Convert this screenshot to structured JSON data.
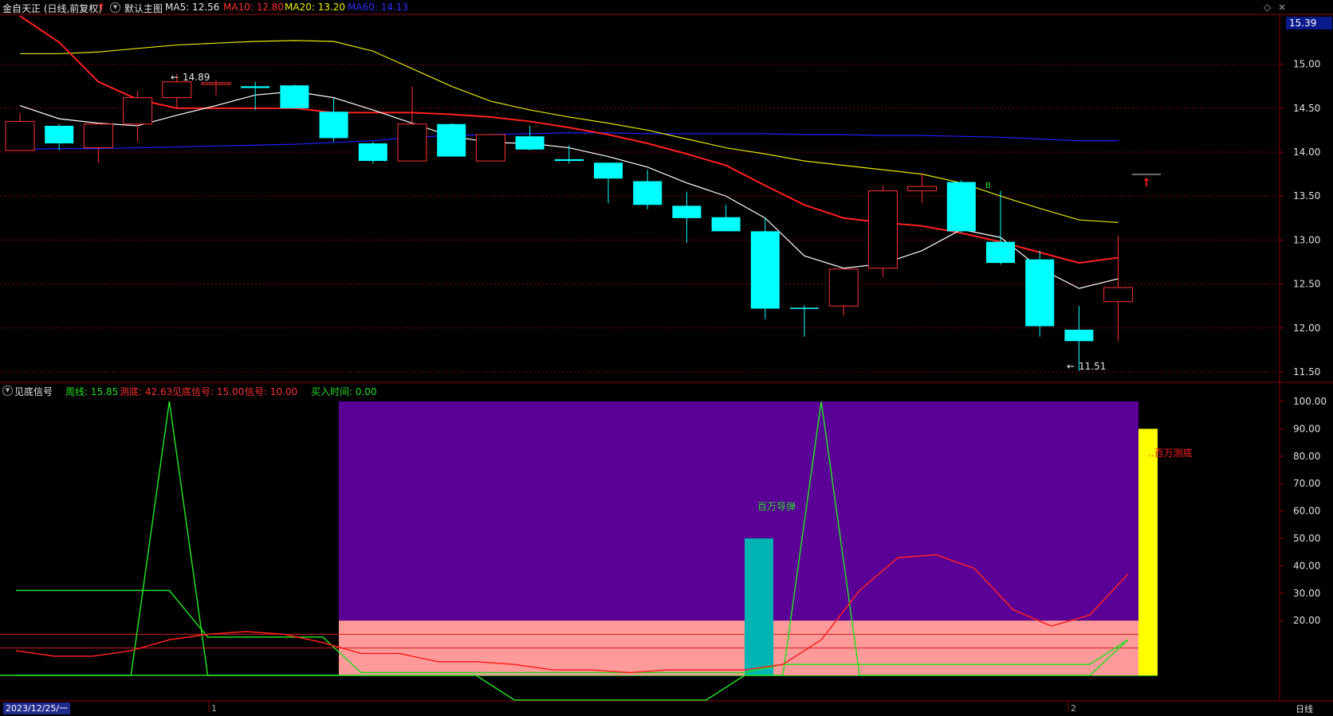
{
  "header": {
    "stock_name": "金自天正 (日线,前复权)",
    "template_label": "默认主图",
    "ma5": "MA5: 12.56",
    "ma10": "MA10: 12.80",
    "ma20": "MA20: 13.20",
    "ma60": "MA60: 14.13",
    "up_arrow": "↑",
    "collapse_glyph": "▾"
  },
  "price_axis": {
    "current_price": "15.39",
    "ticks": [
      "15.00",
      "14.50",
      "14.00",
      "13.50",
      "13.00",
      "12.50",
      "12.00",
      "11.50"
    ]
  },
  "price_annotations": {
    "high": "14.89",
    "low": "11.51"
  },
  "indicator": {
    "name": "见底信号",
    "zhouxian": "周线: 15.85",
    "cedi": "测底: 42.63",
    "jiandi": "见底信号: 15.00",
    "xinhao": "信号: 10.00",
    "buytime": "买入时间: 0.00",
    "ticks": [
      "100.00",
      "90.00",
      "80.00",
      "70.00",
      "60.00",
      "50.00",
      "40.00",
      "30.00",
      "20.00"
    ],
    "label_missile": "百万导弹",
    "label_cedi": "..百万测底"
  },
  "footer": {
    "date": "2023/12/25/一",
    "month_1": "1",
    "month_2": "2",
    "period": "日线"
  },
  "colors": {
    "up": "#ff3232",
    "down": "#00ffff",
    "ma5": "#ffffff",
    "ma10": "#ff2020",
    "ma20": "#e6e600",
    "ma60": "#2020ff",
    "grid": "#8b0000",
    "purple": "#5b0096",
    "pink": "#ff9a9a",
    "teal": "#00b4b4",
    "yellow": "#ffff00",
    "green_line": "#22dd22"
  },
  "chart_data": {
    "type": "candlestick",
    "candles": [
      {
        "o": 14.02,
        "h": 14.45,
        "c": 14.35,
        "l": 14.02
      },
      {
        "o": 14.3,
        "h": 14.32,
        "c": 14.1,
        "l": 14.02
      },
      {
        "o": 14.05,
        "h": 14.33,
        "c": 14.32,
        "l": 13.88
      },
      {
        "o": 14.32,
        "h": 14.7,
        "c": 14.62,
        "l": 14.12
      },
      {
        "o": 14.62,
        "h": 14.89,
        "c": 14.8,
        "l": 14.5
      },
      {
        "o": 14.77,
        "h": 14.82,
        "c": 14.79,
        "l": 14.65
      },
      {
        "o": 14.75,
        "h": 14.8,
        "c": 14.73,
        "l": 14.48
      },
      {
        "o": 14.76,
        "h": 14.77,
        "c": 14.5,
        "l": 14.5
      },
      {
        "o": 14.46,
        "h": 14.62,
        "c": 14.16,
        "l": 14.12
      },
      {
        "o": 14.1,
        "h": 14.12,
        "c": 13.9,
        "l": 13.87
      },
      {
        "o": 13.9,
        "h": 14.75,
        "c": 14.32,
        "l": 13.9
      },
      {
        "o": 14.32,
        "h": 14.33,
        "c": 13.95,
        "l": 13.95
      },
      {
        "o": 13.9,
        "h": 14.2,
        "c": 14.2,
        "l": 13.9
      },
      {
        "o": 14.18,
        "h": 14.3,
        "c": 14.03,
        "l": 14.02
      },
      {
        "o": 13.92,
        "h": 14.08,
        "c": 13.9,
        "l": 13.87
      },
      {
        "o": 13.88,
        "h": 13.88,
        "c": 13.7,
        "l": 13.42
      },
      {
        "o": 13.67,
        "h": 13.8,
        "c": 13.4,
        "l": 13.35
      },
      {
        "o": 13.39,
        "h": 13.55,
        "c": 13.25,
        "l": 12.97
      },
      {
        "o": 13.26,
        "h": 13.4,
        "c": 13.1,
        "l": 13.1
      },
      {
        "o": 13.1,
        "h": 13.25,
        "c": 12.22,
        "l": 12.1
      },
      {
        "o": 12.23,
        "h": 12.26,
        "c": 12.22,
        "l": 11.9
      },
      {
        "o": 12.25,
        "h": 12.68,
        "c": 12.67,
        "l": 12.14
      },
      {
        "o": 12.68,
        "h": 13.62,
        "c": 13.56,
        "l": 12.58
      },
      {
        "o": 13.56,
        "h": 13.76,
        "c": 13.61,
        "l": 13.42
      },
      {
        "o": 13.66,
        "h": 13.68,
        "c": 13.1,
        "l": 13.08
      },
      {
        "o": 12.98,
        "h": 13.56,
        "c": 12.74,
        "l": 12.72
      },
      {
        "o": 12.78,
        "h": 12.88,
        "c": 12.02,
        "l": 11.9
      },
      {
        "o": 11.98,
        "h": 12.25,
        "c": 11.85,
        "l": 11.51
      },
      {
        "o": 12.3,
        "h": 13.05,
        "c": 12.46,
        "l": 11.85
      }
    ],
    "ma5": [
      14.53,
      14.38,
      14.33,
      14.3,
      14.42,
      14.53,
      14.65,
      14.69,
      14.62,
      14.48,
      14.33,
      14.18,
      14.11,
      14.1,
      14.05,
      13.95,
      13.83,
      13.65,
      13.5,
      13.25,
      12.82,
      12.68,
      12.73,
      12.88,
      13.12,
      13.03,
      12.68,
      12.45,
      12.56
    ],
    "ma10": [
      15.55,
      15.25,
      14.8,
      14.6,
      14.5,
      14.5,
      14.5,
      14.5,
      14.45,
      14.45,
      14.45,
      14.43,
      14.4,
      14.35,
      14.28,
      14.2,
      14.1,
      13.98,
      13.85,
      13.62,
      13.4,
      13.25,
      13.2,
      13.16,
      13.08,
      12.98,
      12.86,
      12.74,
      12.8
    ],
    "ma20": [
      15.12,
      15.12,
      15.14,
      15.18,
      15.22,
      15.24,
      15.26,
      15.27,
      15.26,
      15.15,
      14.95,
      14.75,
      14.58,
      14.48,
      14.4,
      14.33,
      14.25,
      14.15,
      14.05,
      13.98,
      13.9,
      13.85,
      13.8,
      13.75,
      13.65,
      13.5,
      13.36,
      13.23,
      13.2
    ],
    "ma60": [
      14.03,
      14.04,
      14.04,
      14.05,
      14.06,
      14.07,
      14.08,
      14.09,
      14.11,
      14.13,
      14.17,
      14.19,
      14.2,
      14.21,
      14.22,
      14.22,
      14.21,
      14.21,
      14.21,
      14.21,
      14.2,
      14.2,
      14.19,
      14.19,
      14.18,
      14.17,
      14.15,
      14.13,
      14.13
    ],
    "price_range": [
      11.4,
      15.55
    ],
    "indicator_range": [
      0,
      100
    ],
    "zhouxian_series": [
      0,
      0,
      0,
      0,
      100,
      0,
      0,
      0,
      0,
      0,
      0,
      0,
      0,
      -9,
      -9,
      -9,
      -9,
      -9,
      -9,
      0,
      0,
      100,
      0,
      0,
      0,
      0,
      0,
      0,
      0,
      13
    ],
    "cedi_series": [
      9,
      7,
      7,
      9,
      13,
      15,
      16,
      15,
      12,
      8,
      8,
      5,
      5,
      4,
      2,
      2,
      1,
      2,
      2,
      2,
      4,
      13,
      31,
      43,
      44,
      39,
      24,
      18,
      22,
      37
    ],
    "green_base_series": [
      31,
      31,
      31,
      31,
      31,
      14,
      14,
      14,
      14,
      1,
      1,
      1,
      1,
      1,
      1,
      1,
      1,
      1,
      1,
      1,
      4,
      4,
      4,
      4,
      4,
      4,
      4,
      4,
      4,
      13
    ]
  }
}
